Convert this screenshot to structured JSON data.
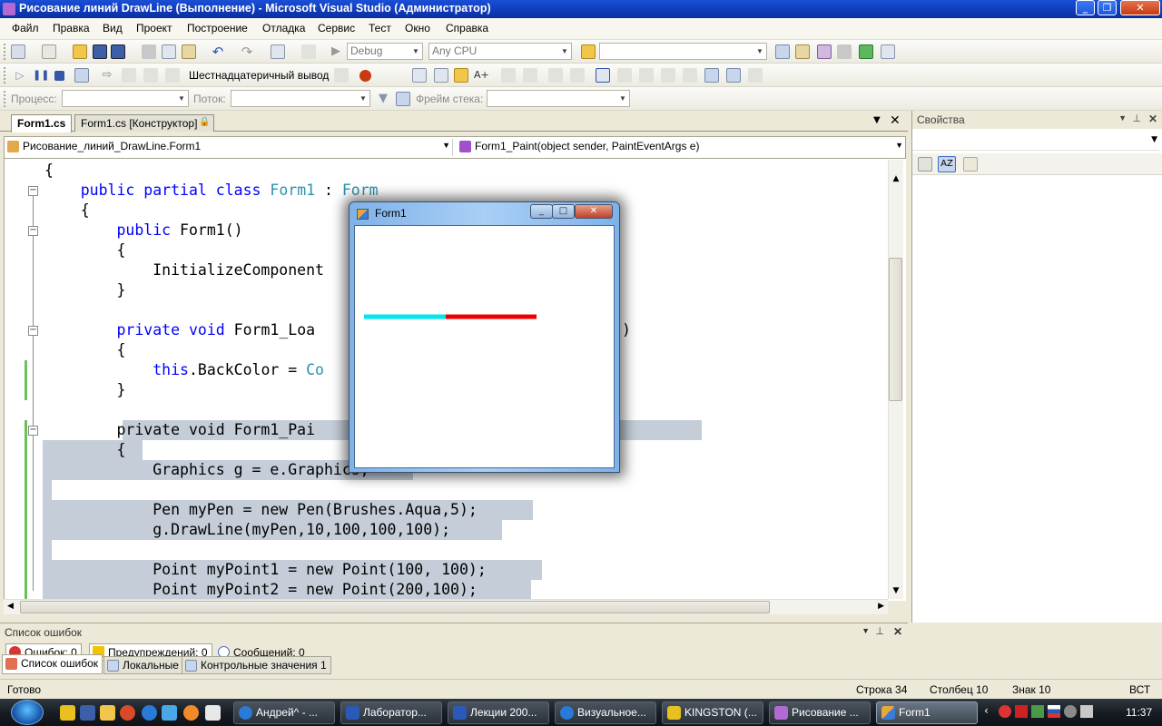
{
  "window": {
    "title": "Рисование линий DrawLine (Выполнение) - Microsoft Visual Studio (Администратор)"
  },
  "menu": [
    "Файл",
    "Правка",
    "Вид",
    "Проект",
    "Построение",
    "Отладка",
    "Сервис",
    "Тест",
    "Окно",
    "Справка"
  ],
  "toolbar": {
    "config": "Debug",
    "platform": "Any CPU",
    "hex_output": "Шестнадцатеричный вывод",
    "process_label": "Процесс:",
    "thread_label": "Поток:",
    "stackframe_label": "Фрейм стека:"
  },
  "doc_tabs": [
    "Form1.cs",
    "Form1.cs [Конструктор]"
  ],
  "nav": {
    "class_combo": "Рисование_линий_DrawLine.Form1",
    "member_combo": "Form1_Paint(object sender, PaintEventArgs e)"
  },
  "code_lines": [
    "{",
    "    public partial class Form1 : Form",
    "    {",
    "        public Form1()",
    "        {",
    "            InitializeComponent",
    "        }",
    "",
    "        private void Form1_Loa",
    "        {",
    "            this.BackColor = Co",
    "        }",
    "",
    "        private void Form1_Pai                  Args e)",
    "        {",
    "            Graphics g = e.Graphics;",
    "",
    "            Pen myPen = new Pen(Brushes.Aqua,5);",
    "            g.DrawLine(myPen,10,100,100,100);",
    "",
    "            Point myPoint1 = new Point(100, 100);",
    "            Point myPoint2 = new Point(200,100);"
  ],
  "code_tokens": {
    "kw_public": "public",
    "kw_partial": "partial",
    "kw_class": "class",
    "type_form1": "Form1",
    "colon": " : ",
    "type_form": "Form",
    "kw_private": "private",
    "kw_void": "void",
    "kw_this": "this",
    "paren_right": ")"
  },
  "properties": {
    "title": "Свойства"
  },
  "error_list": {
    "title": "Список ошибок",
    "errors": "Ошибок: 0",
    "warnings": "Предупреждений: 0",
    "messages": "Сообщений: 0"
  },
  "bottom_tabs": [
    "Список ошибок",
    "Локальные",
    "Контрольные значения 1"
  ],
  "status": {
    "ready": "Готово",
    "line": "Строка 34",
    "col": "Столбец 10",
    "ch": "Знак 10",
    "mode": "ВСТ"
  },
  "taskbar": {
    "buttons": [
      "Андрей^ - ...",
      "Лаборатор...",
      "Лекции 200...",
      "Визуальное...",
      "KINGSTON (...",
      "Рисование ...",
      "Form1"
    ],
    "clock": "11:37"
  },
  "form1": {
    "title": "Form1",
    "line1_color": "#00e5ee",
    "line2_color": "#ee0000"
  }
}
